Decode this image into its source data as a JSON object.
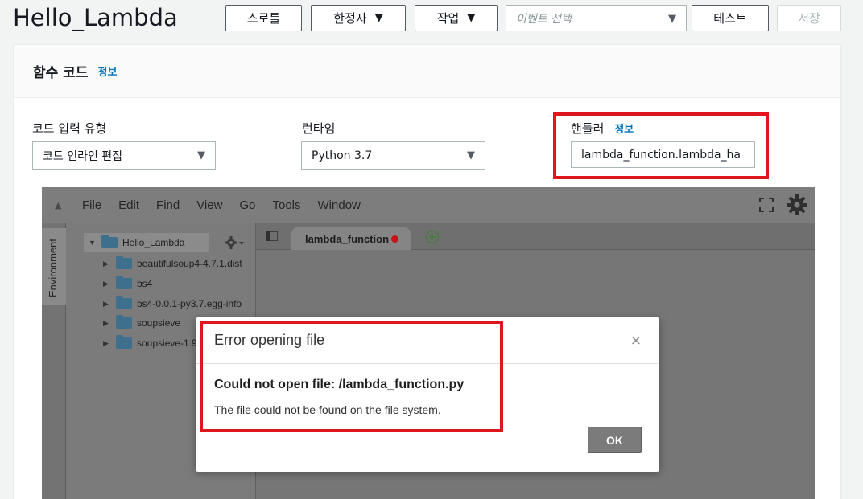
{
  "header": {
    "title": "Hello_Lambda",
    "throttle_label": "스로틀",
    "qualifier_label": "한정자",
    "actions_label": "작업",
    "event_placeholder": "이벤트 선택",
    "test_label": "테스트",
    "save_label": "저장"
  },
  "panel": {
    "title": "함수 코드",
    "info": "정보",
    "code_entry_label": "코드 입력 유형",
    "code_entry_value": "코드 인라인 편집",
    "runtime_label": "런타임",
    "runtime_value": "Python 3.7",
    "handler_label": "핸들러",
    "handler_info": "정보",
    "handler_value": "lambda_function.lambda_ha"
  },
  "ide": {
    "menu": [
      "File",
      "Edit",
      "Find",
      "View",
      "Go",
      "Tools",
      "Window"
    ],
    "side_tab": "Environment",
    "tree_root": "Hello_Lambda",
    "tree_items": [
      "beautifulsoup4-4.7.1.dist",
      "bs4",
      "bs4-0.0.1-py3.7.egg-info",
      "soupsieve",
      "soupsieve-1.9"
    ],
    "file_tab": "lambda_function"
  },
  "dialog": {
    "title": "Error opening file",
    "close": "×",
    "message": "Could not open file: /lambda_function.py",
    "detail": "The file could not be found on the file system.",
    "ok": "OK"
  },
  "colors": {
    "highlight": "#e0161e",
    "link": "#0073bb",
    "unsaved_dot": "#c0151b"
  }
}
